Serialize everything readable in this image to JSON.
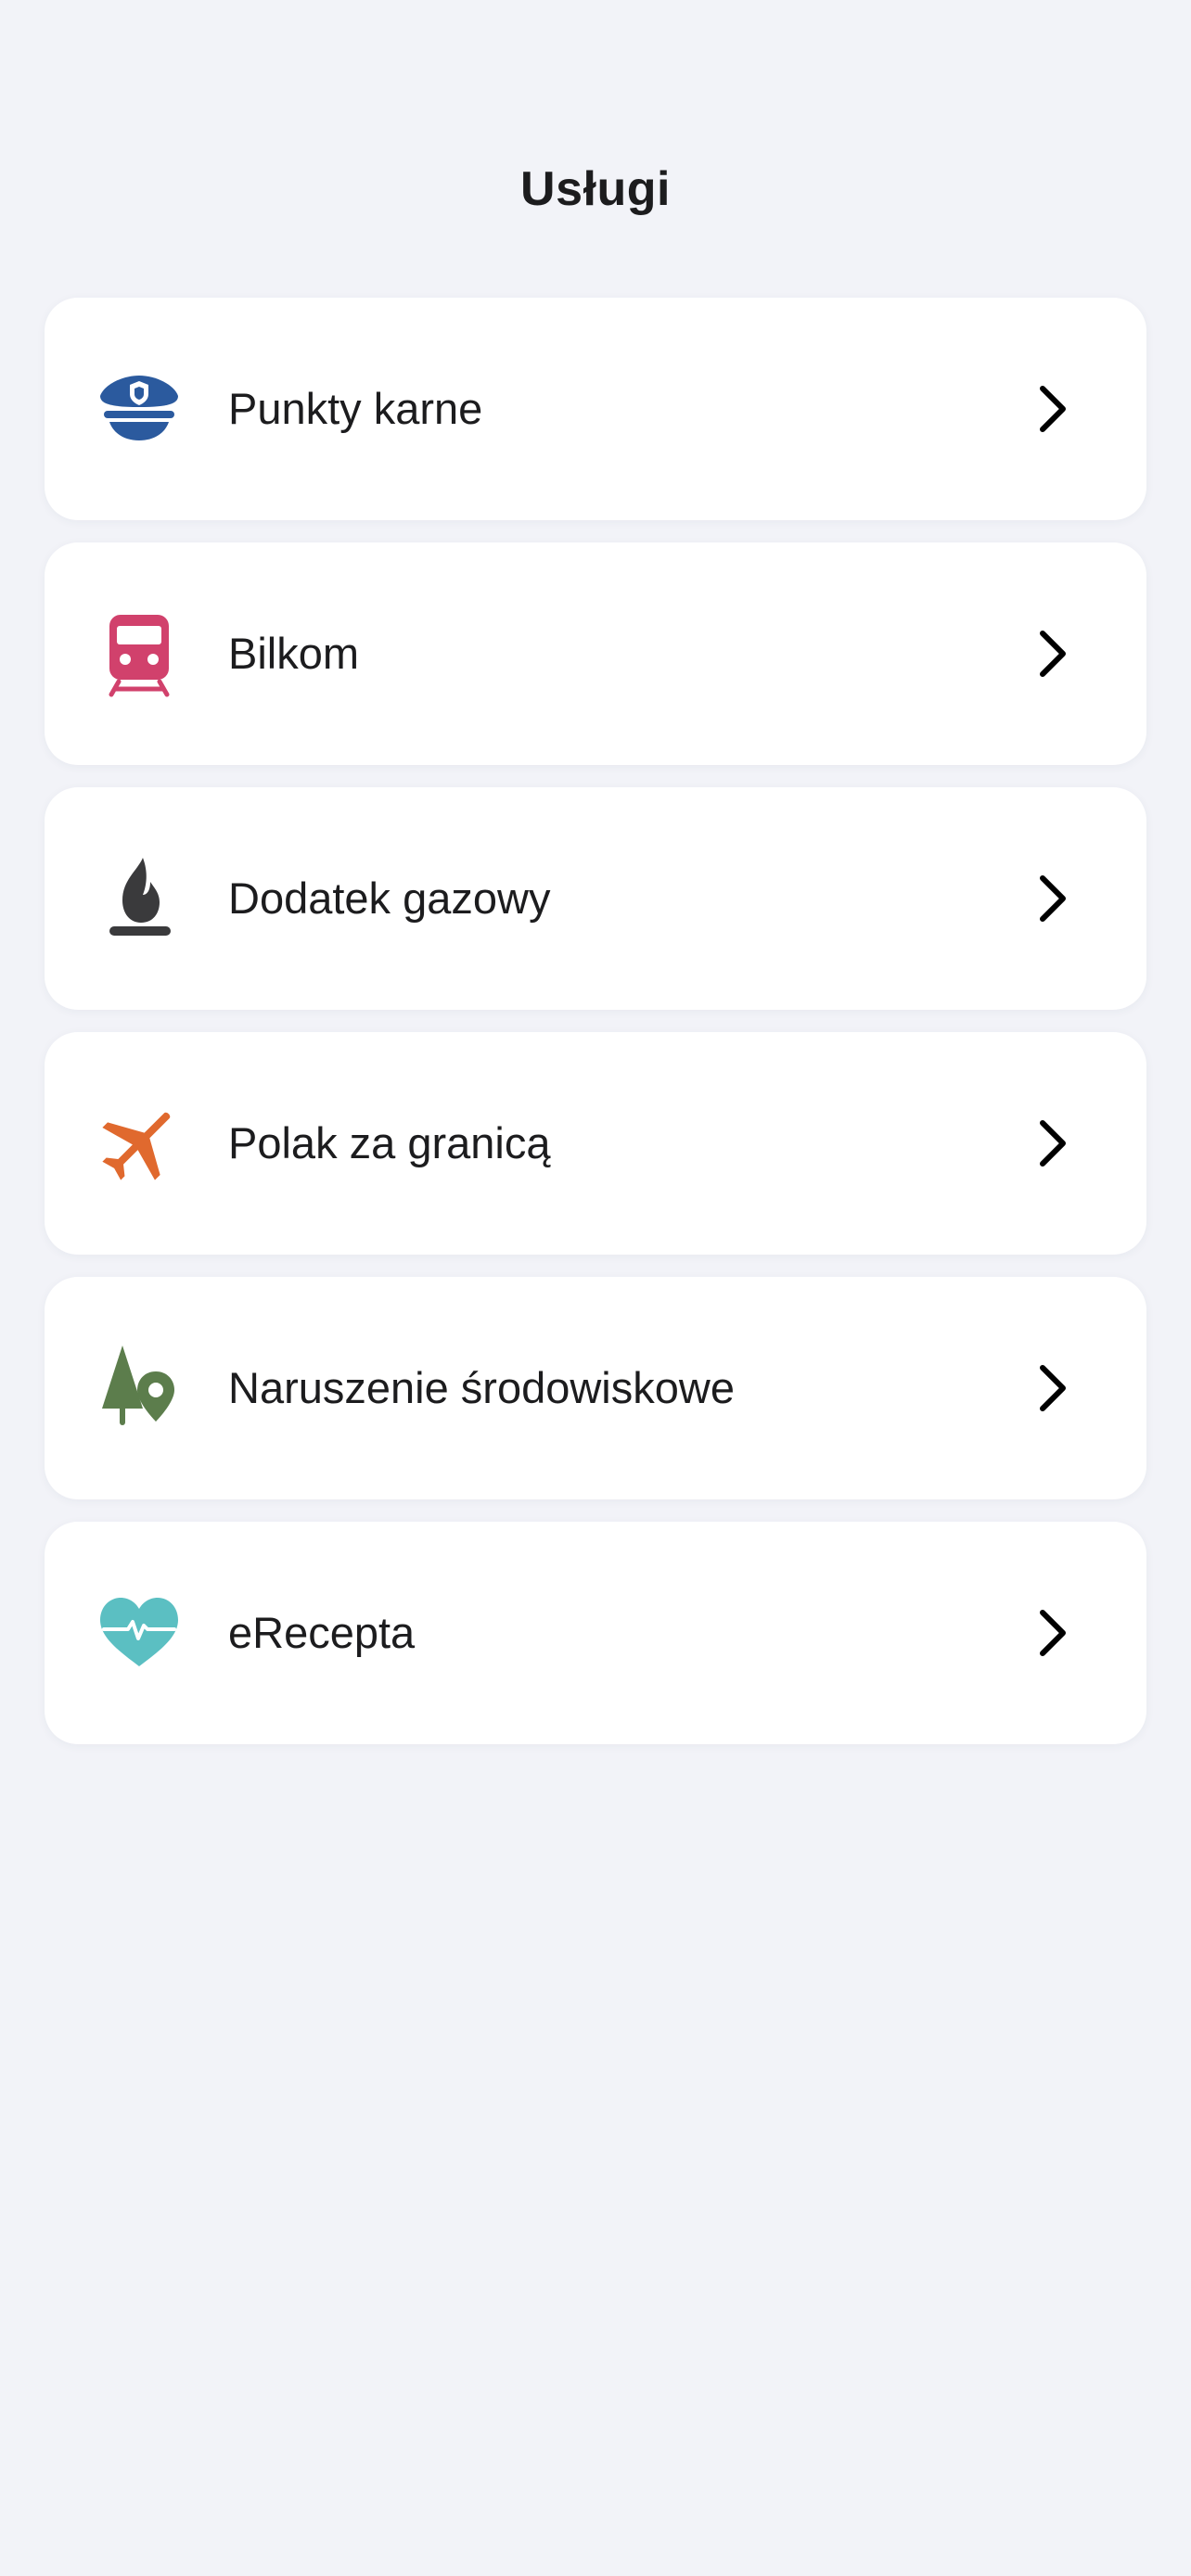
{
  "header": {
    "title": "Usługi"
  },
  "services": [
    {
      "label": "Punkty karne",
      "icon": "police-cap-icon",
      "color": "#2b5a9e"
    },
    {
      "label": "Bilkom",
      "icon": "train-icon",
      "color": "#d1416c"
    },
    {
      "label": "Dodatek gazowy",
      "icon": "gas-flame-icon",
      "color": "#3a3a3c"
    },
    {
      "label": "Polak za granicą",
      "icon": "airplane-icon",
      "color": "#e0692e"
    },
    {
      "label": "Naruszenie środowiskowe",
      "icon": "tree-location-icon",
      "color": "#5c7d4c"
    },
    {
      "label": "eRecepta",
      "icon": "heart-pulse-icon",
      "color": "#5bbfc2"
    }
  ],
  "chevron_color": "#000000"
}
